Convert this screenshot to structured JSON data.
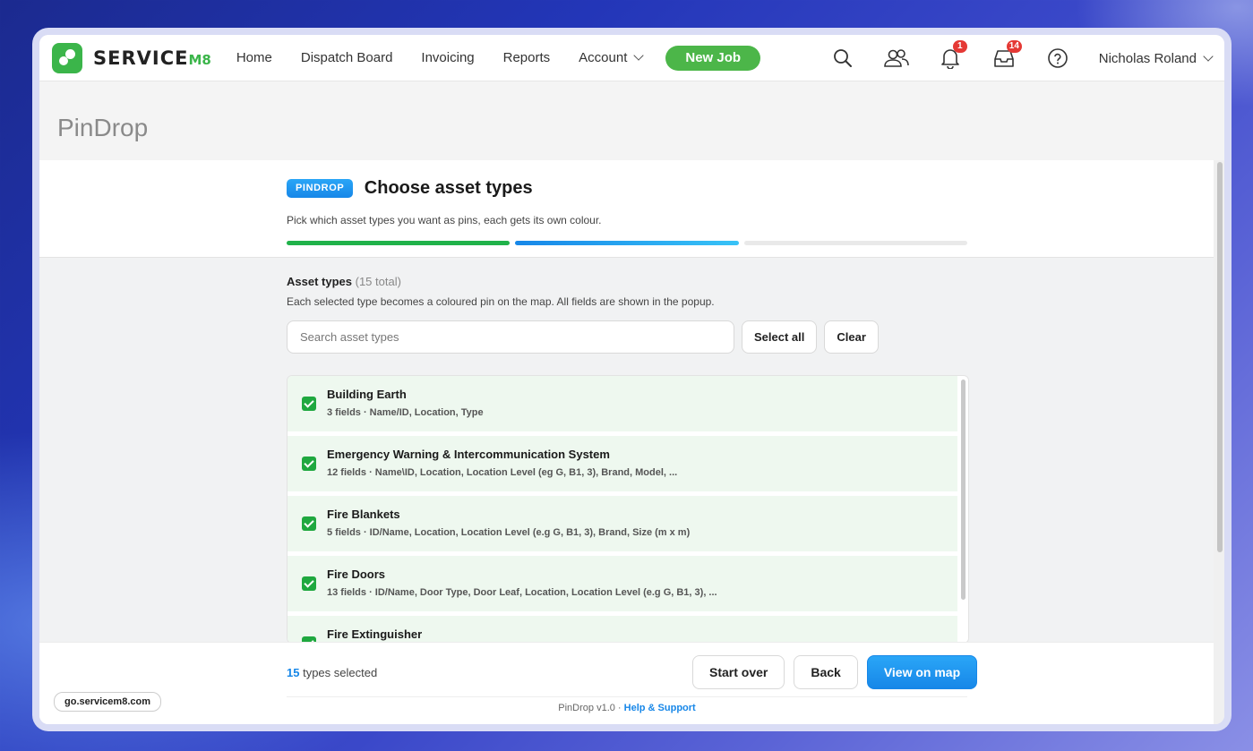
{
  "brand": {
    "name": "SERVICE",
    "suffix": "M8",
    "accent": "#3bb54a"
  },
  "nav": {
    "items": [
      {
        "label": "Home"
      },
      {
        "label": "Dispatch Board"
      },
      {
        "label": "Invoicing"
      },
      {
        "label": "Reports"
      }
    ],
    "account_label": "Account",
    "new_job_label": "New Job",
    "notifications_badge": "1",
    "inbox_badge": "14",
    "user_name": "Nicholas Roland",
    "icons": [
      "search-icon",
      "people-icon",
      "bell-icon",
      "inbox-icon",
      "help-icon"
    ]
  },
  "page": {
    "title": "PinDrop"
  },
  "wizard": {
    "pill": "PINDROP",
    "heading": "Choose asset types",
    "subtitle": "Pick which asset types you want as pins, each gets its own colour.",
    "progress_colors": [
      "#20b24a",
      "#1e9bf0",
      "#e9e9e9"
    ]
  },
  "assets": {
    "title": "Asset types",
    "total": "(15 total)",
    "description": "Each selected type becomes a coloured pin on the map. All fields are shown in the popup.",
    "search_placeholder": "Search asset types",
    "select_all_label": "Select all",
    "clear_label": "Clear",
    "items": [
      {
        "name": "Building Earth",
        "meta": "3 fields · Name/ID, Location, Type",
        "checked": true
      },
      {
        "name": "Emergency Warning & Intercommunication System",
        "meta": "12 fields · Name\\ID, Location, Location Level (eg G, B1, 3), Brand, Model, ...",
        "checked": true
      },
      {
        "name": "Fire Blankets",
        "meta": "5 fields · ID/Name, Location, Location Level (e.g G, B1, 3), Brand, Size (m x m)",
        "checked": true
      },
      {
        "name": "Fire Doors",
        "meta": "13 fields · ID/Name, Door Type, Door Leaf, Location, Location Level (e.g G, B1, 3), ...",
        "checked": true
      },
      {
        "name": "Fire Extinguisher",
        "meta": "",
        "checked": true
      }
    ]
  },
  "footer": {
    "selected_count": "15",
    "selected_label": "types selected",
    "start_over_label": "Start over",
    "back_label": "Back",
    "view_map_label": "View on map",
    "version": "PinDrop v1.0 ·",
    "support_label": "Help & Support",
    "url": "go.servicem8.com"
  }
}
